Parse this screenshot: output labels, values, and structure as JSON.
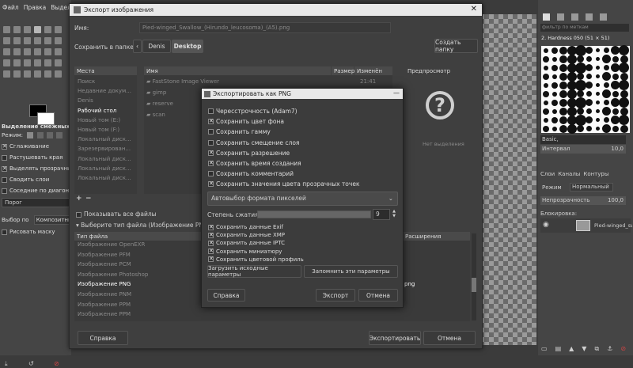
{
  "menubar": {
    "items": [
      "Файл",
      "Правка",
      "Выделе"
    ]
  },
  "toolbox": {
    "section_title": "Выделение смежных обл",
    "mode_label": "Режим:",
    "options": [
      {
        "label": "Сглаживание",
        "checked": true
      },
      {
        "label": "Растушевать края",
        "checked": false
      },
      {
        "label": "Выделять прозрачные об",
        "checked": true
      },
      {
        "label": "Сводить слои",
        "checked": false
      },
      {
        "label": "Соседние по диагонали",
        "checked": false
      }
    ],
    "threshold_label": "Порог",
    "select_by_label": "Выбор по",
    "select_by_value": "Композитный",
    "draw_mask_label": "Рисовать маску"
  },
  "export_dialog": {
    "title": "Экспорт изображения",
    "name_label": "Имя:",
    "name_value": "Pied-winged_Swallow_(Hirundo_leucosoma)_(A5).png",
    "save_in_label": "Сохранить в папке:",
    "path": [
      "Denis",
      "Desktop"
    ],
    "create_folder": "Создать папку",
    "places_header": "Места",
    "places": [
      "Поиск",
      "Недавние докум...",
      "Denis",
      "Рабочий стол",
      "Новый том (E:)",
      "Новый том (F:)",
      "Локальный диск...",
      "Зарезервирован...",
      "Локальный диск...",
      "Локальный диск...",
      "Локальный диск..."
    ],
    "places_selected_index": 3,
    "columns": {
      "name": "Имя",
      "size": "Размер",
      "modified": "Изменён"
    },
    "files": [
      {
        "name": "FastStone Image Viewer",
        "size": "",
        "modified": "21:41"
      },
      {
        "name": "gimp",
        "size": "",
        "modified": ""
      },
      {
        "name": "reserve",
        "size": "",
        "modified": ""
      },
      {
        "name": "scan",
        "size": "",
        "modified": ""
      }
    ],
    "preview_header": "Предпросмотр",
    "preview_empty": "Нет выделения",
    "add_remove": [
      "+",
      "−"
    ],
    "show_all_files": "Показывать все файлы",
    "select_type": "Выберите тип файла (Изображение PNG)",
    "type_header": "Тип файла",
    "ext_header": "Расширения",
    "types": [
      "Изображение OpenEXR",
      "Изображение PFM",
      "Изображение PCM",
      "Изображение Photoshop",
      "Изображение PNG",
      "Изображение PNM",
      "Изображение PPM",
      "Изображение PPM"
    ],
    "exts": [
      "",
      "",
      "",
      "",
      "png",
      "",
      "",
      ""
    ],
    "type_selected_index": 4,
    "help_button": "Справка",
    "export_button": "Экспортировать",
    "cancel_button": "Отмена"
  },
  "png_dialog": {
    "title": "Экспортировать как PNG",
    "options": [
      {
        "label": "Чересстрочность (Adam7)",
        "checked": false
      },
      {
        "label": "Сохранить цвет фона",
        "checked": true
      },
      {
        "label": "Сохранить гамму",
        "checked": false
      },
      {
        "label": "Сохранить смещение слоя",
        "checked": false
      },
      {
        "label": "Сохранить разрешение",
        "checked": true
      },
      {
        "label": "Сохранить время создания",
        "checked": true
      },
      {
        "label": "Сохранить комментарий",
        "checked": false
      },
      {
        "label": "Сохранить значения цвета прозрачных точек",
        "checked": true
      }
    ],
    "format_select": "Автовыбор формата пикселей",
    "compression_label": "Степень сжатия:",
    "compression_value": "9",
    "compression_level": 1.0,
    "metadata": [
      {
        "label": "Сохранить данные Exif",
        "checked": true
      },
      {
        "label": "Сохранить данные XMP",
        "checked": true
      },
      {
        "label": "Сохранить данные IPTC",
        "checked": true
      },
      {
        "label": "Сохранить миниатюру",
        "checked": true
      },
      {
        "label": "Сохранить цветовой профиль",
        "checked": true
      }
    ],
    "load_defaults": "Загрузить исходные параметры",
    "save_defaults": "Запомнить эти параметры",
    "help": "Справка",
    "export": "Экспорт",
    "cancel": "Отмена"
  },
  "right_dock": {
    "filter_placeholder": "фильтр по меткам",
    "brush_name": "2. Hardness 050 (51 × 51)",
    "preset": "Basic,",
    "spacing_label": "Интервал",
    "spacing_value": "10,0",
    "tabs": [
      "Слои",
      "Каналы",
      "Контуры"
    ],
    "mode_label": "Режим",
    "mode_value": "Нормальный",
    "opacity_label": "Непрозрачность",
    "opacity_value": "100,0",
    "lock_label": "Блокировка:",
    "layer_name": "Pied-winged_swa"
  }
}
